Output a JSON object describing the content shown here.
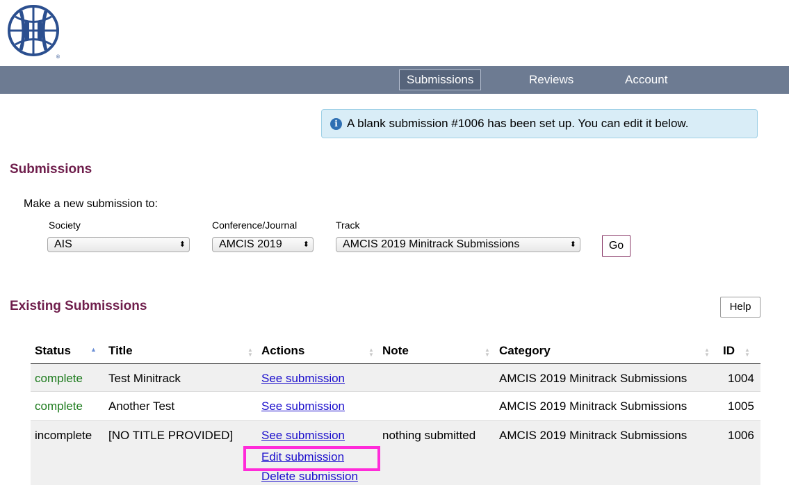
{
  "nav": {
    "items": [
      "Submissions",
      "Reviews",
      "Account"
    ]
  },
  "alert": {
    "text": "A blank submission #1006 has been set up. You can edit it below."
  },
  "submissions": {
    "heading": "Submissions",
    "new_label": "Make a new submission to:",
    "society_label": "Society",
    "society_value": "AIS",
    "conf_label": "Conference/Journal",
    "conf_value": "AMCIS 2019",
    "track_label": "Track",
    "track_value": "AMCIS 2019 Minitrack Submissions",
    "go_label": "Go"
  },
  "existing": {
    "heading": "Existing Submissions",
    "help_label": "Help",
    "columns": [
      "Status",
      "Title",
      "Actions",
      "Note",
      "Category",
      "ID"
    ],
    "rows": [
      {
        "status": "complete",
        "title": "Test Minitrack",
        "actions": [
          "See submission"
        ],
        "note": "",
        "category": "AMCIS 2019 Minitrack Submissions",
        "id": "1004"
      },
      {
        "status": "complete",
        "title": "Another Test",
        "actions": [
          "See submission"
        ],
        "note": "",
        "category": "AMCIS 2019 Minitrack Submissions",
        "id": "1005"
      },
      {
        "status": "incomplete",
        "title": "[NO TITLE PROVIDED]",
        "actions": [
          "See submission",
          "Edit submission",
          "Delete submission"
        ],
        "note": "nothing submitted",
        "category": "AMCIS 2019 Minitrack Submissions",
        "id": "1006"
      }
    ]
  },
  "colors": {
    "nav_bg": "#6d7b92",
    "heading": "#6e1d4b",
    "alert_bg": "#d9edf7",
    "status_complete": "#1b7a1b",
    "link": "#1a0dcc",
    "highlight": "#ff2bd9"
  }
}
